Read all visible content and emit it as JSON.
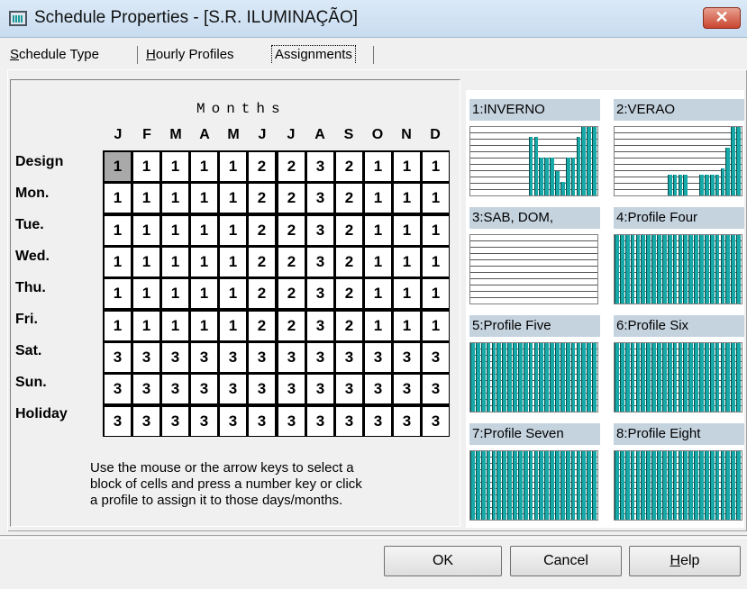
{
  "window": {
    "title": "Schedule Properties - [S.R. ILUMINAÇÃO]",
    "close_glyph": "✕"
  },
  "tabs": [
    {
      "label": "Schedule Type",
      "mnemonic": "S",
      "rest": "chedule Type"
    },
    {
      "label": "Hourly Profiles",
      "mnemonic": "H",
      "rest": "ourly Profiles"
    },
    {
      "label": "Assignments",
      "mnemonic": "",
      "rest": "Assignments",
      "active": true
    }
  ],
  "grid": {
    "title": "Months",
    "months": [
      "J",
      "F",
      "M",
      "A",
      "M",
      "J",
      "J",
      "A",
      "S",
      "O",
      "N",
      "D"
    ],
    "days": [
      "Design",
      "Mon.",
      "Tue.",
      "Wed.",
      "Thu.",
      "Fri.",
      "Sat.",
      "Sun.",
      "Holiday"
    ],
    "values": [
      [
        1,
        1,
        1,
        1,
        1,
        2,
        2,
        3,
        2,
        1,
        1,
        1
      ],
      [
        1,
        1,
        1,
        1,
        1,
        2,
        2,
        3,
        2,
        1,
        1,
        1
      ],
      [
        1,
        1,
        1,
        1,
        1,
        2,
        2,
        3,
        2,
        1,
        1,
        1
      ],
      [
        1,
        1,
        1,
        1,
        1,
        2,
        2,
        3,
        2,
        1,
        1,
        1
      ],
      [
        1,
        1,
        1,
        1,
        1,
        2,
        2,
        3,
        2,
        1,
        1,
        1
      ],
      [
        1,
        1,
        1,
        1,
        1,
        2,
        2,
        3,
        2,
        1,
        1,
        1
      ],
      [
        3,
        3,
        3,
        3,
        3,
        3,
        3,
        3,
        3,
        3,
        3,
        3
      ],
      [
        3,
        3,
        3,
        3,
        3,
        3,
        3,
        3,
        3,
        3,
        3,
        3
      ],
      [
        3,
        3,
        3,
        3,
        3,
        3,
        3,
        3,
        3,
        3,
        3,
        3
      ]
    ],
    "selected_cell": {
      "row": 0,
      "col": 0
    }
  },
  "help_text": [
    "Use the mouse or the arrow keys to select a",
    "block of cells and press a number key or click",
    "a profile to assign it to those days/months."
  ],
  "profiles": [
    {
      "label": "1:INVERNO",
      "hourly": [
        0,
        0,
        0,
        0,
        0,
        0,
        0,
        0,
        0,
        0,
        0,
        0.85,
        0.85,
        0.55,
        0.55,
        0.55,
        0.35,
        0.2,
        0.55,
        0.55,
        0.85,
        1,
        1,
        1
      ]
    },
    {
      "label": "2:VERAO",
      "hourly": [
        0,
        0,
        0,
        0,
        0,
        0,
        0,
        0,
        0,
        0,
        0.3,
        0.3,
        0.3,
        0.3,
        0,
        0,
        0.3,
        0.3,
        0.3,
        0.3,
        0.4,
        0.7,
        1,
        1
      ]
    },
    {
      "label": "3:SAB, DOM,",
      "hourly": [
        0,
        0,
        0,
        0,
        0,
        0,
        0,
        0,
        0,
        0,
        0,
        0,
        0,
        0,
        0,
        0,
        0,
        0,
        0,
        0,
        0,
        0,
        0,
        0
      ]
    },
    {
      "label": "4:Profile Four",
      "hourly": [
        1,
        1,
        1,
        1,
        1,
        1,
        1,
        1,
        1,
        1,
        1,
        1,
        1,
        1,
        1,
        1,
        1,
        1,
        1,
        1,
        1,
        1,
        1,
        1
      ]
    },
    {
      "label": "5:Profile Five",
      "hourly": [
        1,
        1,
        1,
        1,
        1,
        1,
        1,
        1,
        1,
        1,
        1,
        1,
        1,
        1,
        1,
        1,
        1,
        1,
        1,
        1,
        1,
        1,
        1,
        1
      ]
    },
    {
      "label": "6:Profile Six",
      "hourly": [
        1,
        1,
        1,
        1,
        1,
        1,
        1,
        1,
        1,
        1,
        1,
        1,
        1,
        1,
        1,
        1,
        1,
        1,
        1,
        1,
        1,
        1,
        1,
        1
      ]
    },
    {
      "label": "7:Profile Seven",
      "hourly": [
        1,
        1,
        1,
        1,
        1,
        1,
        1,
        1,
        1,
        1,
        1,
        1,
        1,
        1,
        1,
        1,
        1,
        1,
        1,
        1,
        1,
        1,
        1,
        1
      ]
    },
    {
      "label": "8:Profile Eight",
      "hourly": [
        1,
        1,
        1,
        1,
        1,
        1,
        1,
        1,
        1,
        1,
        1,
        1,
        1,
        1,
        1,
        1,
        1,
        1,
        1,
        1,
        1,
        1,
        1,
        1
      ]
    }
  ],
  "buttons": {
    "ok": "OK",
    "cancel": "Cancel",
    "help_mnemonic": "H",
    "help_rest": "elp"
  },
  "colors": {
    "bar": "#17a8a8",
    "profile_header": "#c5d3df",
    "selected_cell": "#a9a9a9"
  }
}
